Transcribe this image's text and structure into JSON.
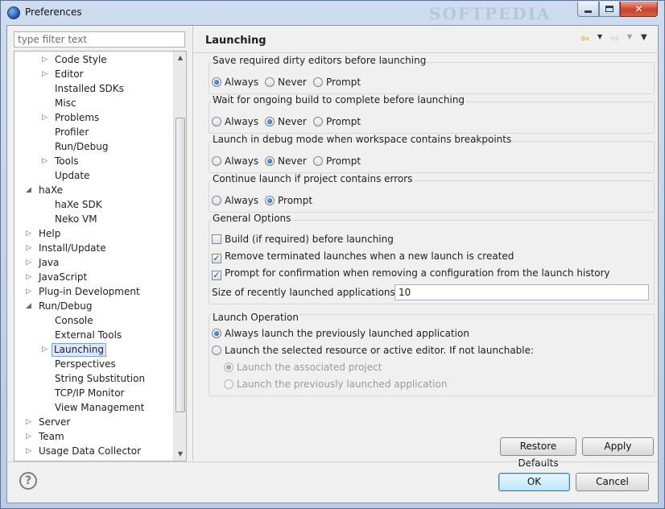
{
  "window": {
    "title": "Preferences",
    "watermark": "SOFTPEDIA"
  },
  "filter": {
    "placeholder": "type filter text"
  },
  "tree": [
    {
      "label": "Code Style",
      "indent": 2,
      "toggle": "collapsed"
    },
    {
      "label": "Editor",
      "indent": 2,
      "toggle": "collapsed"
    },
    {
      "label": "Installed SDKs",
      "indent": 2,
      "toggle": "none"
    },
    {
      "label": "Misc",
      "indent": 2,
      "toggle": "none"
    },
    {
      "label": "Problems",
      "indent": 2,
      "toggle": "collapsed"
    },
    {
      "label": "Profiler",
      "indent": 2,
      "toggle": "none"
    },
    {
      "label": "Run/Debug",
      "indent": 2,
      "toggle": "none"
    },
    {
      "label": "Tools",
      "indent": 2,
      "toggle": "collapsed"
    },
    {
      "label": "Update",
      "indent": 2,
      "toggle": "none"
    },
    {
      "label": "haXe",
      "indent": 1,
      "toggle": "expanded"
    },
    {
      "label": "haXe SDK",
      "indent": 2,
      "toggle": "none"
    },
    {
      "label": "Neko VM",
      "indent": 2,
      "toggle": "none"
    },
    {
      "label": "Help",
      "indent": 1,
      "toggle": "collapsed"
    },
    {
      "label": "Install/Update",
      "indent": 1,
      "toggle": "collapsed"
    },
    {
      "label": "Java",
      "indent": 1,
      "toggle": "collapsed"
    },
    {
      "label": "JavaScript",
      "indent": 1,
      "toggle": "collapsed"
    },
    {
      "label": "Plug-in Development",
      "indent": 1,
      "toggle": "collapsed"
    },
    {
      "label": "Run/Debug",
      "indent": 1,
      "toggle": "expanded"
    },
    {
      "label": "Console",
      "indent": 2,
      "toggle": "none"
    },
    {
      "label": "External Tools",
      "indent": 2,
      "toggle": "none"
    },
    {
      "label": "Launching",
      "indent": 2,
      "toggle": "collapsed",
      "selected": true
    },
    {
      "label": "Perspectives",
      "indent": 2,
      "toggle": "none"
    },
    {
      "label": "String Substitution",
      "indent": 2,
      "toggle": "none"
    },
    {
      "label": "TCP/IP Monitor",
      "indent": 2,
      "toggle": "none"
    },
    {
      "label": "View Management",
      "indent": 2,
      "toggle": "none"
    },
    {
      "label": "Server",
      "indent": 1,
      "toggle": "collapsed"
    },
    {
      "label": "Team",
      "indent": 1,
      "toggle": "collapsed"
    },
    {
      "label": "Usage Data Collector",
      "indent": 1,
      "toggle": "collapsed"
    }
  ],
  "page": {
    "title": "Launching",
    "groups": [
      {
        "label": "Save required dirty editors before launching",
        "options": [
          "Always",
          "Never",
          "Prompt"
        ],
        "selected": 0
      },
      {
        "label": "Wait for ongoing build to complete before launching",
        "options": [
          "Always",
          "Never",
          "Prompt"
        ],
        "selected": 1
      },
      {
        "label": "Launch in debug mode when workspace contains breakpoints",
        "options": [
          "Always",
          "Never",
          "Prompt"
        ],
        "selected": 1
      },
      {
        "label": "Continue launch if project contains errors",
        "options": [
          "Always",
          "Prompt"
        ],
        "selected": 1
      }
    ],
    "general": {
      "label": "General Options",
      "checks": [
        {
          "label": "Build (if required) before launching",
          "checked": false
        },
        {
          "label": "Remove terminated launches when a new launch is created",
          "checked": true
        },
        {
          "label": "Prompt for confirmation when removing a configuration from the launch history",
          "checked": true
        }
      ],
      "size_label": "Size of recently launched applications list:",
      "size_value": "10"
    },
    "launch_operation": {
      "label": "Launch Operation",
      "always": "Always launch the previously launched application",
      "selected_resource": "Launch the selected resource or active editor. If not launchable:",
      "sub_associated": "Launch the associated project",
      "sub_previous": "Launch the previously launched application"
    },
    "restore_defaults": "Restore Defaults",
    "apply": "Apply"
  },
  "dialog": {
    "ok": "OK",
    "cancel": "Cancel",
    "help": "?"
  }
}
